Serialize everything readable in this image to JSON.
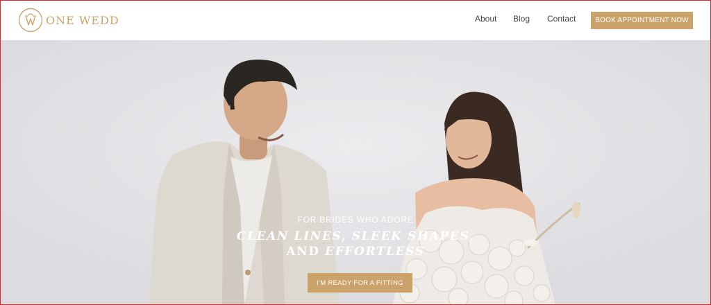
{
  "brand": {
    "name": "ONE WEDD"
  },
  "nav": {
    "about": "About",
    "blog": "Blog",
    "contact": "Contact"
  },
  "header": {
    "cta_label": "BOOK APPOINTMENT NOW"
  },
  "hero": {
    "kicker": "FOR BRIDES WHO ADORE",
    "headline_line1": "CLEAN LINES, SLEEK SHAPES,",
    "headline_line2_plain": "AND",
    "headline_line2_italic": "EFFORTLESS",
    "cta_label": "I'M READY FOR A FITTING"
  },
  "colors": {
    "accent": "#cba26a",
    "logo": "#c9a56c"
  }
}
